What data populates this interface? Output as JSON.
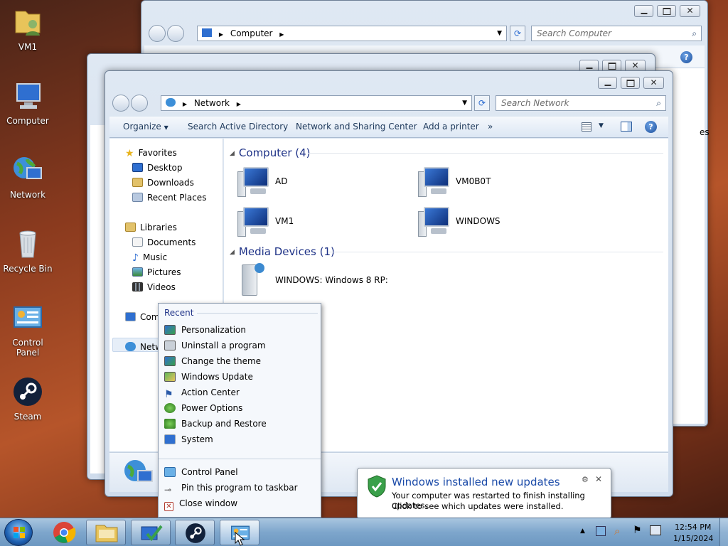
{
  "desktop_icons": [
    {
      "label": "VM1",
      "icon": "user-folder-icon"
    },
    {
      "label": "Computer",
      "icon": "computer-icon"
    },
    {
      "label": "Network",
      "icon": "network-icon"
    },
    {
      "label": "Recycle Bin",
      "icon": "recycle-bin-icon"
    },
    {
      "label": "Control Panel",
      "icon": "control-panel-icon"
    },
    {
      "label": "Steam",
      "icon": "steam-icon"
    }
  ],
  "back_window": {
    "address": "Computer",
    "search_placeholder": "Search Computer",
    "side_text": "es"
  },
  "front_window": {
    "address": "Network",
    "search_placeholder": "Search Network",
    "toolbar": {
      "organize": "Organize",
      "search_ad": "Search Active Directory",
      "network_center": "Network and Sharing Center",
      "add_printer": "Add a printer",
      "more": "»"
    },
    "nav": {
      "favorites": "Favorites",
      "desktop": "Desktop",
      "downloads": "Downloads",
      "recent_places": "Recent Places",
      "libraries": "Libraries",
      "documents": "Documents",
      "music": "Music",
      "pictures": "Pictures",
      "videos": "Videos",
      "computer": "Com",
      "network": "Netw"
    },
    "groups": {
      "computer": {
        "header": "Computer (4)",
        "items": [
          "AD",
          "VM0B0T",
          "VM1",
          "WINDOWS"
        ]
      },
      "media": {
        "header": "Media Devices (1)",
        "items": [
          "WINDOWS: Windows 8 RP:"
        ]
      }
    }
  },
  "jump_list": {
    "header": "Recent",
    "recent": [
      "Personalization",
      "Uninstall a program",
      "Change the theme",
      "Windows Update",
      "Action Center",
      "Power Options",
      "Backup and Restore",
      "System"
    ],
    "tasks": [
      "Control Panel",
      "Pin this program to taskbar",
      "Close window"
    ]
  },
  "notification": {
    "title": "Windows installed new updates",
    "line1": "Your computer was restarted to finish installing updates.",
    "line2": "Click to see which updates were installed.",
    "close": "✕"
  },
  "taskbar": {
    "items": [
      "start-orb",
      "chrome",
      "explorer",
      "action-center-app",
      "steam",
      "control-panel"
    ],
    "time": "12:54 PM",
    "date": "1/15/2024"
  },
  "colors": {
    "link_blue": "#1e3287",
    "title_blue": "#1a4aa8"
  }
}
